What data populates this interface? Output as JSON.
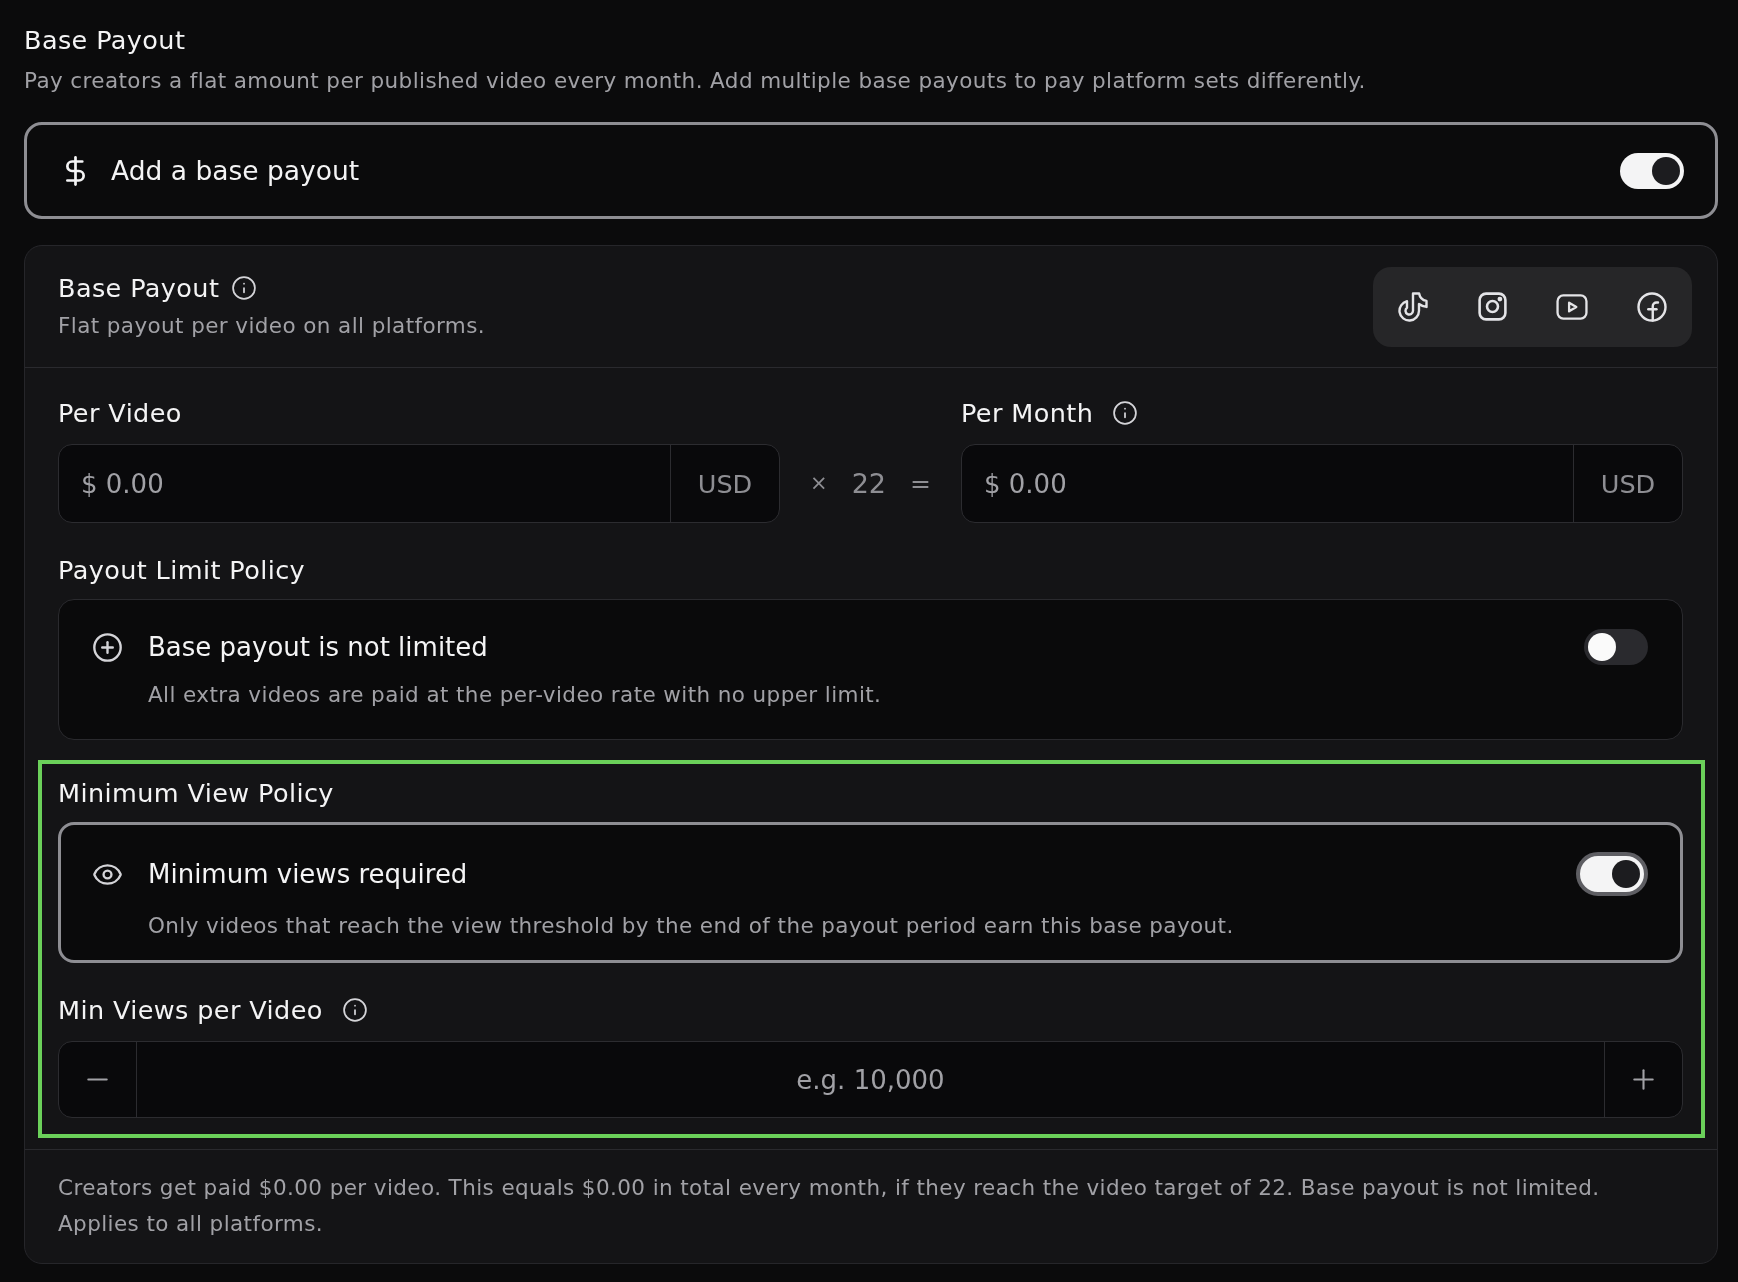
{
  "section": {
    "title": "Base Payout",
    "description": "Pay creators a flat amount per published video every month. Add multiple base payouts to pay platform sets differently."
  },
  "base_payout_toggle": {
    "label": "Add a base payout",
    "on": true
  },
  "payout_card": {
    "title": "Base Payout",
    "info": true,
    "subtitle": "Flat payout per video on all platforms."
  },
  "rate": {
    "per_video": {
      "label": "Per Video",
      "placeholder": "$ 0.00",
      "currency": "USD"
    },
    "operator": "×",
    "multiplier": "22",
    "equals": "=",
    "per_month": {
      "label": "Per Month",
      "info": true,
      "placeholder": "$ 0.00",
      "currency": "USD"
    }
  },
  "policies": [
    {
      "heading": "Payout Limit Policy",
      "kind": "limit",
      "title": "Base payout is not limited",
      "description": "All extra videos are paid at the per-video rate with no upper limit.",
      "on": false,
      "focused": false,
      "highlighted": false
    },
    {
      "heading": "Minimum View Policy",
      "kind": "views",
      "title": "Minimum views required",
      "description": "Only videos that reach the view threshold by the end of the payout period earn this base payout.",
      "on": true,
      "focused": true,
      "highlighted": true,
      "field": {
        "label": "Min Views per Video",
        "info": true,
        "placeholder": "e.g. 10,000"
      }
    }
  ],
  "summary": "Creators get paid $0.00 per video. This equals $0.00 in total every month, if they reach the video target of 22. Base payout is not limited. Applies to all platforms."
}
